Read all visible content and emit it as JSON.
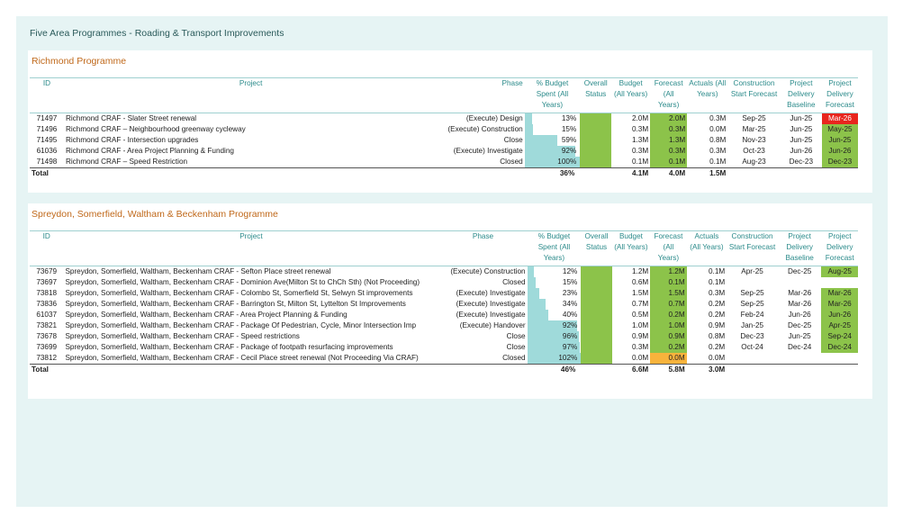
{
  "dashboard": {
    "title": "Five Area Programmes - Roading & Transport Improvements"
  },
  "headers": {
    "id": "ID",
    "project": "Project",
    "phase": "Phase",
    "pct": "% Budget Spent (All Years)",
    "status": "Overall Status",
    "budget": "Budget (All Years)",
    "forecast": "Forecast (All Years)",
    "actuals": "Actuals (All Years)",
    "construction": "Construction Start Forecast",
    "baseline": "Project Delivery Baseline",
    "delivery_forecast": "Project Delivery Forecast"
  },
  "colors": {
    "green": "#8cc34a",
    "red": "#e8261e",
    "amber": "#f8b33c",
    "bar": "#9fdada"
  },
  "richmond": {
    "title": "Richmond Programme",
    "rows": [
      {
        "id": "71497",
        "project": "Richmond CRAF - Slater Street renewal",
        "phase": "(Execute) Design",
        "pct": "13%",
        "pct_value": 13,
        "budget": "2.0M",
        "forecast": "2.0M",
        "forecast_color": "green",
        "actuals": "0.3M",
        "construction": "Sep-25",
        "baseline": "Jun-25",
        "delivery": "Mar-26",
        "delivery_color": "red"
      },
      {
        "id": "71496",
        "project": "Richmond CRAF – Neighbourhood greenway cycleway",
        "phase": "(Execute) Construction",
        "pct": "15%",
        "pct_value": 15,
        "budget": "0.3M",
        "forecast": "0.3M",
        "forecast_color": "green",
        "actuals": "0.0M",
        "construction": "Mar-25",
        "baseline": "Jun-25",
        "delivery": "May-25",
        "delivery_color": "green"
      },
      {
        "id": "71495",
        "project": "Richmond CRAF - Intersection upgrades",
        "phase": "Close",
        "pct": "59%",
        "pct_value": 59,
        "budget": "1.3M",
        "forecast": "1.3M",
        "forecast_color": "green",
        "actuals": "0.8M",
        "construction": "Nov-23",
        "baseline": "Jun-25",
        "delivery": "Jun-25",
        "delivery_color": "green"
      },
      {
        "id": "61036",
        "project": "Richmond CRAF - Area Project Planning & Funding",
        "phase": "(Execute) Investigate",
        "pct": "92%",
        "pct_value": 92,
        "budget": "0.3M",
        "forecast": "0.3M",
        "forecast_color": "green",
        "actuals": "0.3M",
        "construction": "Oct-23",
        "baseline": "Jun-26",
        "delivery": "Jun-26",
        "delivery_color": "green"
      },
      {
        "id": "71498",
        "project": "Richmond CRAF – Speed Restriction",
        "phase": "Closed",
        "pct": "100%",
        "pct_value": 100,
        "budget": "0.1M",
        "forecast": "0.1M",
        "forecast_color": "green",
        "actuals": "0.1M",
        "construction": "Aug-23",
        "baseline": "Dec-23",
        "delivery": "Dec-23",
        "delivery_color": "green"
      }
    ],
    "total": {
      "label": "Total",
      "pct": "36%",
      "budget": "4.1M",
      "forecast": "4.0M",
      "actuals": "1.5M"
    }
  },
  "spreydon": {
    "title": "Spreydon, Somerfield, Waltham & Beckenham Programme",
    "rows": [
      {
        "id": "73679",
        "project": "Spreydon, Somerfield, Waltham, Beckenham CRAF - Sefton Place street renewal",
        "phase": "(Execute) Construction",
        "pct": "12%",
        "pct_value": 12,
        "budget": "1.2M",
        "forecast": "1.2M",
        "forecast_color": "green",
        "actuals": "0.1M",
        "construction": "Apr-25",
        "baseline": "Dec-25",
        "delivery": "Aug-25",
        "delivery_color": "green"
      },
      {
        "id": "73697",
        "project": "Spreydon, Somerfield, Waltham, Beckenham CRAF - Dominion Ave(Milton St to ChCh Sth) (Not Proceeding)",
        "phase": "Closed",
        "pct": "15%",
        "pct_value": 15,
        "budget": "0.6M",
        "forecast": "0.1M",
        "forecast_color": "green",
        "actuals": "0.1M",
        "construction": "",
        "baseline": "",
        "delivery": "",
        "delivery_color": ""
      },
      {
        "id": "73818",
        "project": "Spreydon, Somerfield, Waltham, Beckenham CRAF - Colombo St, Somerfield St, Selwyn St improvements",
        "phase": "(Execute) Investigate",
        "pct": "23%",
        "pct_value": 23,
        "budget": "1.5M",
        "forecast": "1.5M",
        "forecast_color": "green",
        "actuals": "0.3M",
        "construction": "Sep-25",
        "baseline": "Mar-26",
        "delivery": "Mar-26",
        "delivery_color": "green"
      },
      {
        "id": "73836",
        "project": "Spreydon, Somerfield, Waltham, Beckenham CRAF - Barrington St, Milton St, Lyttelton St Improvements",
        "phase": "(Execute) Investigate",
        "pct": "34%",
        "pct_value": 34,
        "budget": "0.7M",
        "forecast": "0.7M",
        "forecast_color": "green",
        "actuals": "0.2M",
        "construction": "Sep-25",
        "baseline": "Mar-26",
        "delivery": "Mar-26",
        "delivery_color": "green"
      },
      {
        "id": "61037",
        "project": "Spreydon, Somerfield, Waltham, Beckenham CRAF - Area Project Planning & Funding",
        "phase": "(Execute) Investigate",
        "pct": "40%",
        "pct_value": 40,
        "budget": "0.5M",
        "forecast": "0.2M",
        "forecast_color": "green",
        "actuals": "0.2M",
        "construction": "Feb-24",
        "baseline": "Jun-26",
        "delivery": "Jun-26",
        "delivery_color": "green"
      },
      {
        "id": "73821",
        "project": "Spreydon, Somerfield, Waltham, Beckenham CRAF - Package Of Pedestrian, Cycle, Minor Intersection Imp",
        "phase": "(Execute) Handover",
        "pct": "92%",
        "pct_value": 92,
        "budget": "1.0M",
        "forecast": "1.0M",
        "forecast_color": "green",
        "actuals": "0.9M",
        "construction": "Jan-25",
        "baseline": "Dec-25",
        "delivery": "Apr-25",
        "delivery_color": "green"
      },
      {
        "id": "73678",
        "project": "Spreydon, Somerfield, Waltham, Beckenham CRAF - Speed restrictions",
        "phase": "Close",
        "pct": "96%",
        "pct_value": 96,
        "budget": "0.9M",
        "forecast": "0.9M",
        "forecast_color": "green",
        "actuals": "0.8M",
        "construction": "Dec-23",
        "baseline": "Jun-25",
        "delivery": "Sep-24",
        "delivery_color": "green"
      },
      {
        "id": "73699",
        "project": "Spreydon, Somerfield, Waltham, Beckenham CRAF - Package of footpath resurfacing improvements",
        "phase": "Close",
        "pct": "97%",
        "pct_value": 97,
        "budget": "0.3M",
        "forecast": "0.2M",
        "forecast_color": "green",
        "actuals": "0.2M",
        "construction": "Oct-24",
        "baseline": "Dec-24",
        "delivery": "Dec-24",
        "delivery_color": "green"
      },
      {
        "id": "73812",
        "project": "Spreydon, Somerfield, Waltham, Beckenham CRAF - Cecil Place street renewal (Not Proceeding Via CRAF)",
        "phase": "Closed",
        "pct": "102%",
        "pct_value": 100,
        "budget": "0.0M",
        "forecast": "0.0M",
        "forecast_color": "amber",
        "actuals": "0.0M",
        "construction": "",
        "baseline": "",
        "delivery": "",
        "delivery_color": ""
      }
    ],
    "total": {
      "label": "Total",
      "pct": "46%",
      "budget": "6.6M",
      "forecast": "5.8M",
      "actuals": "3.0M"
    }
  }
}
